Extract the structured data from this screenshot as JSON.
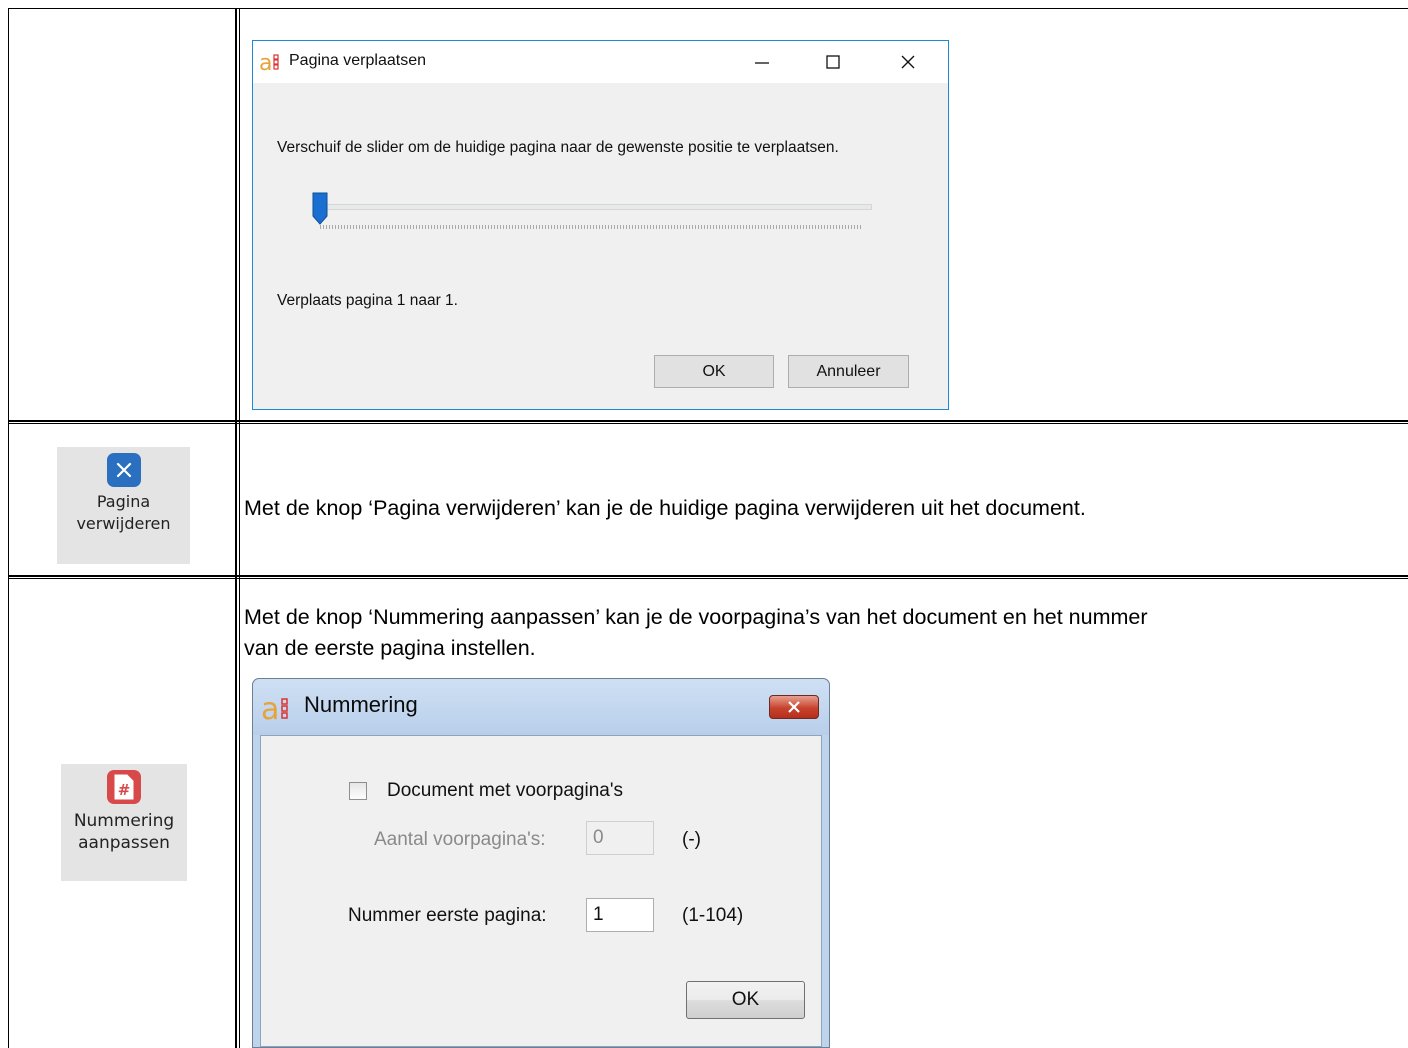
{
  "dialog_move": {
    "title": "Pagina verplaatsen",
    "minimize_icon": "minimize-icon",
    "maximize_icon": "maximize-icon",
    "close_icon": "close-icon",
    "instruction": "Verschuif de slider om de huidige pagina naar de gewenste positie te verplaatsen.",
    "slider_value": 1,
    "status": "Verplaats pagina 1 naar 1.",
    "ok_label": "OK",
    "cancel_label": "Annuleer"
  },
  "row_delete": {
    "button_label_line1": "Pagina",
    "button_label_line2": "verwijderen",
    "button_icon": "close-icon",
    "icon_color": "#2b6fc0",
    "description": "Met de knop ‘Pagina verwijderen’ kan je de huidige pagina verwijderen uit het document."
  },
  "row_numbering": {
    "button_label_line1": "Nummering",
    "button_label_line2": "aanpassen",
    "button_icon": "page-number-icon",
    "icon_color": "#d84a4a",
    "description_line1": "Met de knop ‘Nummering aanpassen’ kan je de voorpagina’s van het document en het nummer",
    "description_line2": "van de eerste pagina instellen."
  },
  "dialog_numbering": {
    "title": "Nummering",
    "checkbox_label": "Document met voorpagina's",
    "checkbox_checked": false,
    "front_pages_label": "Aantal voorpagina's:",
    "front_pages_value": "0",
    "front_pages_range": "(-)",
    "first_page_label": "Nummer eerste pagina:",
    "first_page_value": "1",
    "first_page_range": "(1-104)",
    "ok_label": "OK"
  }
}
